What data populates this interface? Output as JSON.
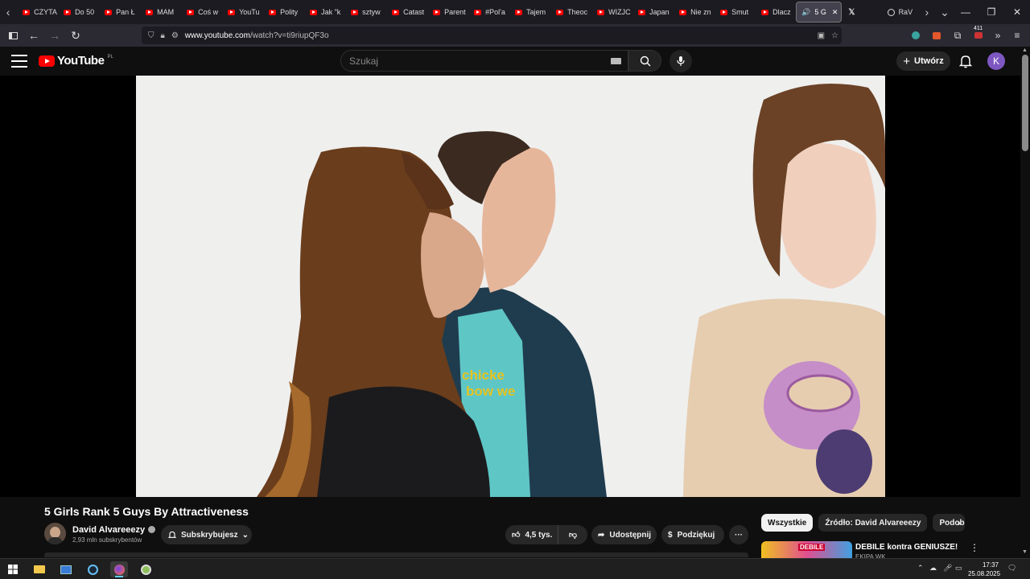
{
  "browser": {
    "tabs": [
      {
        "label": "CZYTA"
      },
      {
        "label": "Do 50"
      },
      {
        "label": "Pan Ł"
      },
      {
        "label": "MAM"
      },
      {
        "label": "Coś w"
      },
      {
        "label": "YouTu"
      },
      {
        "label": "Polity"
      },
      {
        "label": "Jak \"k"
      },
      {
        "label": "sztyw"
      },
      {
        "label": "Catast"
      },
      {
        "label": "Parent"
      },
      {
        "label": "#Pol'a"
      },
      {
        "label": "Tajem"
      },
      {
        "label": "Theoc"
      },
      {
        "label": "WIZJC"
      },
      {
        "label": "Japan"
      },
      {
        "label": "Nie zn"
      },
      {
        "label": "Smut"
      },
      {
        "label": "Dlacz"
      }
    ],
    "active_tab": {
      "label": "5 G"
    },
    "extra_tab": {
      "label": "RaV"
    },
    "url_host": "www.youtube.com",
    "url_path": "/watch?v=ti9riupQF3o",
    "extension_badge": "411"
  },
  "youtube": {
    "logo_text": "YouTube",
    "country_code": "PL",
    "search_placeholder": "Szukaj",
    "create_label": "Utwórz",
    "avatar_letter": "K",
    "accent_color": "#ff0000"
  },
  "video": {
    "title": "5 Girls Rank 5 Guys By Attractiveness",
    "channel_name": "David Alvareeezy",
    "subscribers": "2,93 mln subskrybentów",
    "subscribe_label": "Subskrybujesz",
    "likes": "4,5 tys.",
    "share_label": "Udostępnij",
    "thanks_label": "Podziękuj",
    "shirt_text_1": "chicke",
    "shirt_text_2": "bow we"
  },
  "sidebar": {
    "chips": [
      {
        "label": "Wszystkie"
      },
      {
        "label": "Źródło: David Alvareeezy"
      },
      {
        "label": "Podobne"
      }
    ],
    "recommendation": {
      "title": "DEBILE kontra GENIUSZE!",
      "channel": "EKIPA WK",
      "thumb_text": "DEBILE"
    }
  },
  "taskbar": {
    "time": "17:37",
    "date": "25.08.2025"
  }
}
